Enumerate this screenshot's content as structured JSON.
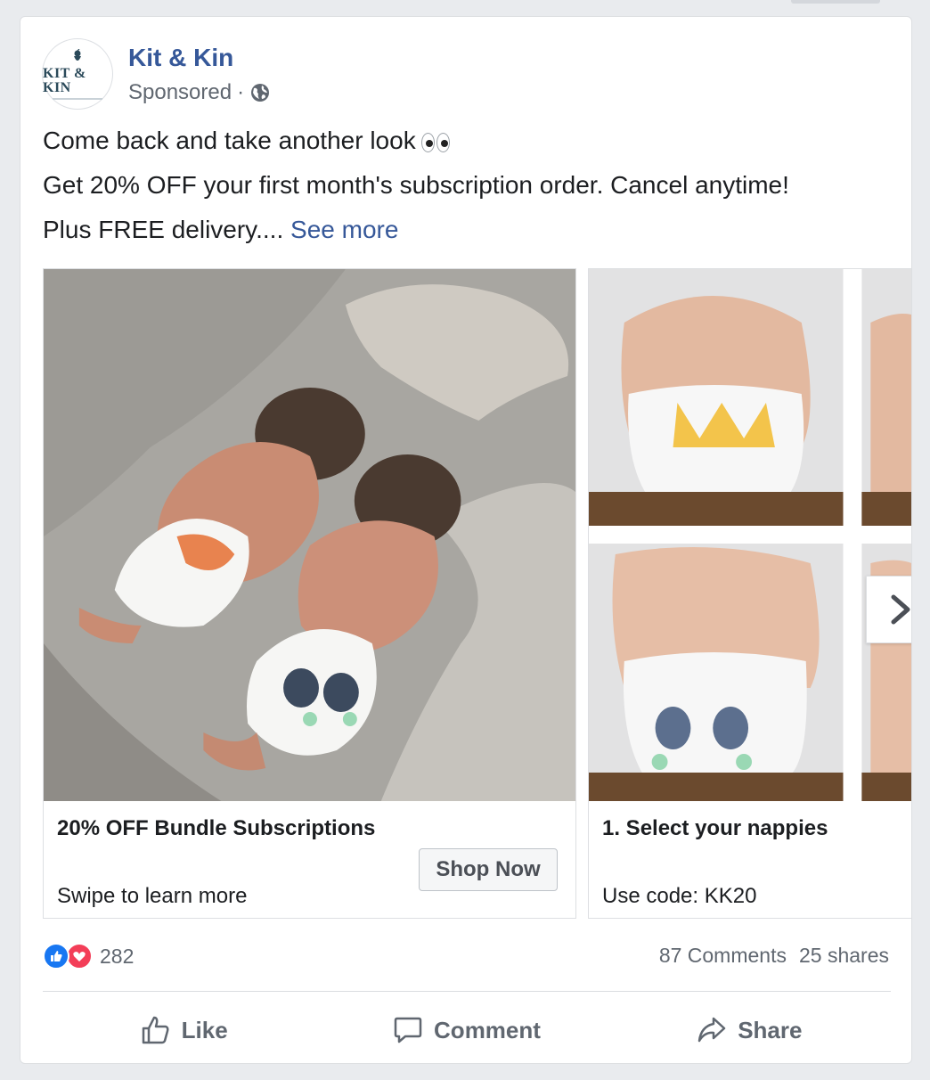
{
  "post": {
    "page_name": "Kit & Kin",
    "sponsored_label": "Sponsored",
    "separator": "·",
    "audience_icon": "globe-icon",
    "avatar_text": "KIT & KIN",
    "line1": "Come back and take another look",
    "line1_emoji": "eyes-emoji",
    "line2": "Get 20% OFF your first month's subscription order. Cancel anytime!",
    "line3": "Plus FREE delivery....",
    "see_more": "See more"
  },
  "carousel": {
    "cards": [
      {
        "headline": "20% OFF Bundle Subscriptions",
        "description": "Swipe to learn more",
        "cta": "Shop Now",
        "image": "twin babies in fox and panda nappies"
      },
      {
        "headline": "1. Select your nappies",
        "description": "Use code: KK20",
        "image": "babies wearing tiger and panda nappies"
      }
    ],
    "next_icon": "chevron-right-icon"
  },
  "stats": {
    "reaction_count": "282",
    "comments": "87 Comments",
    "shares": "25 shares"
  },
  "actions": {
    "like": "Like",
    "comment": "Comment",
    "share": "Share"
  },
  "colors": {
    "link": "#365899",
    "like_blue": "#1877f2",
    "love_red": "#f33e58"
  }
}
